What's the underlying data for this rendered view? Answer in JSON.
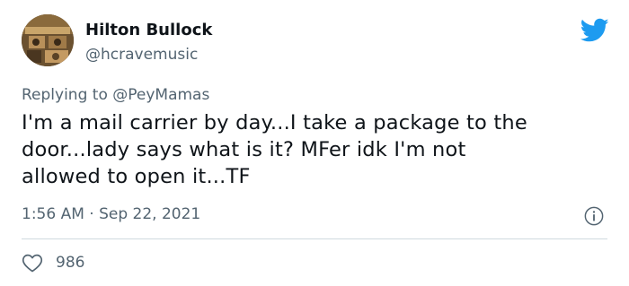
{
  "author": {
    "name": "Hilton Bullock",
    "handle": "@hcravemusic"
  },
  "reply": {
    "prefix": "Replying to ",
    "mention": "@PeyMamas"
  },
  "tweet": {
    "text_lines": [
      "I'm a mail carrier by day...I take a package to the",
      "door...lady says what is it? MFer idk I'm not",
      "allowed to open it...TF"
    ],
    "timestamp": "1:56 AM · Sep 22, 2021"
  },
  "actions": {
    "likes": "986"
  },
  "colors": {
    "twitter_blue": "#1d9bf0",
    "secondary_text": "#536471",
    "primary_text": "#0f1419",
    "divider": "#cfd9de"
  },
  "icons": {
    "logo": "twitter-bird-icon",
    "info": "info-icon",
    "like": "heart-icon"
  }
}
